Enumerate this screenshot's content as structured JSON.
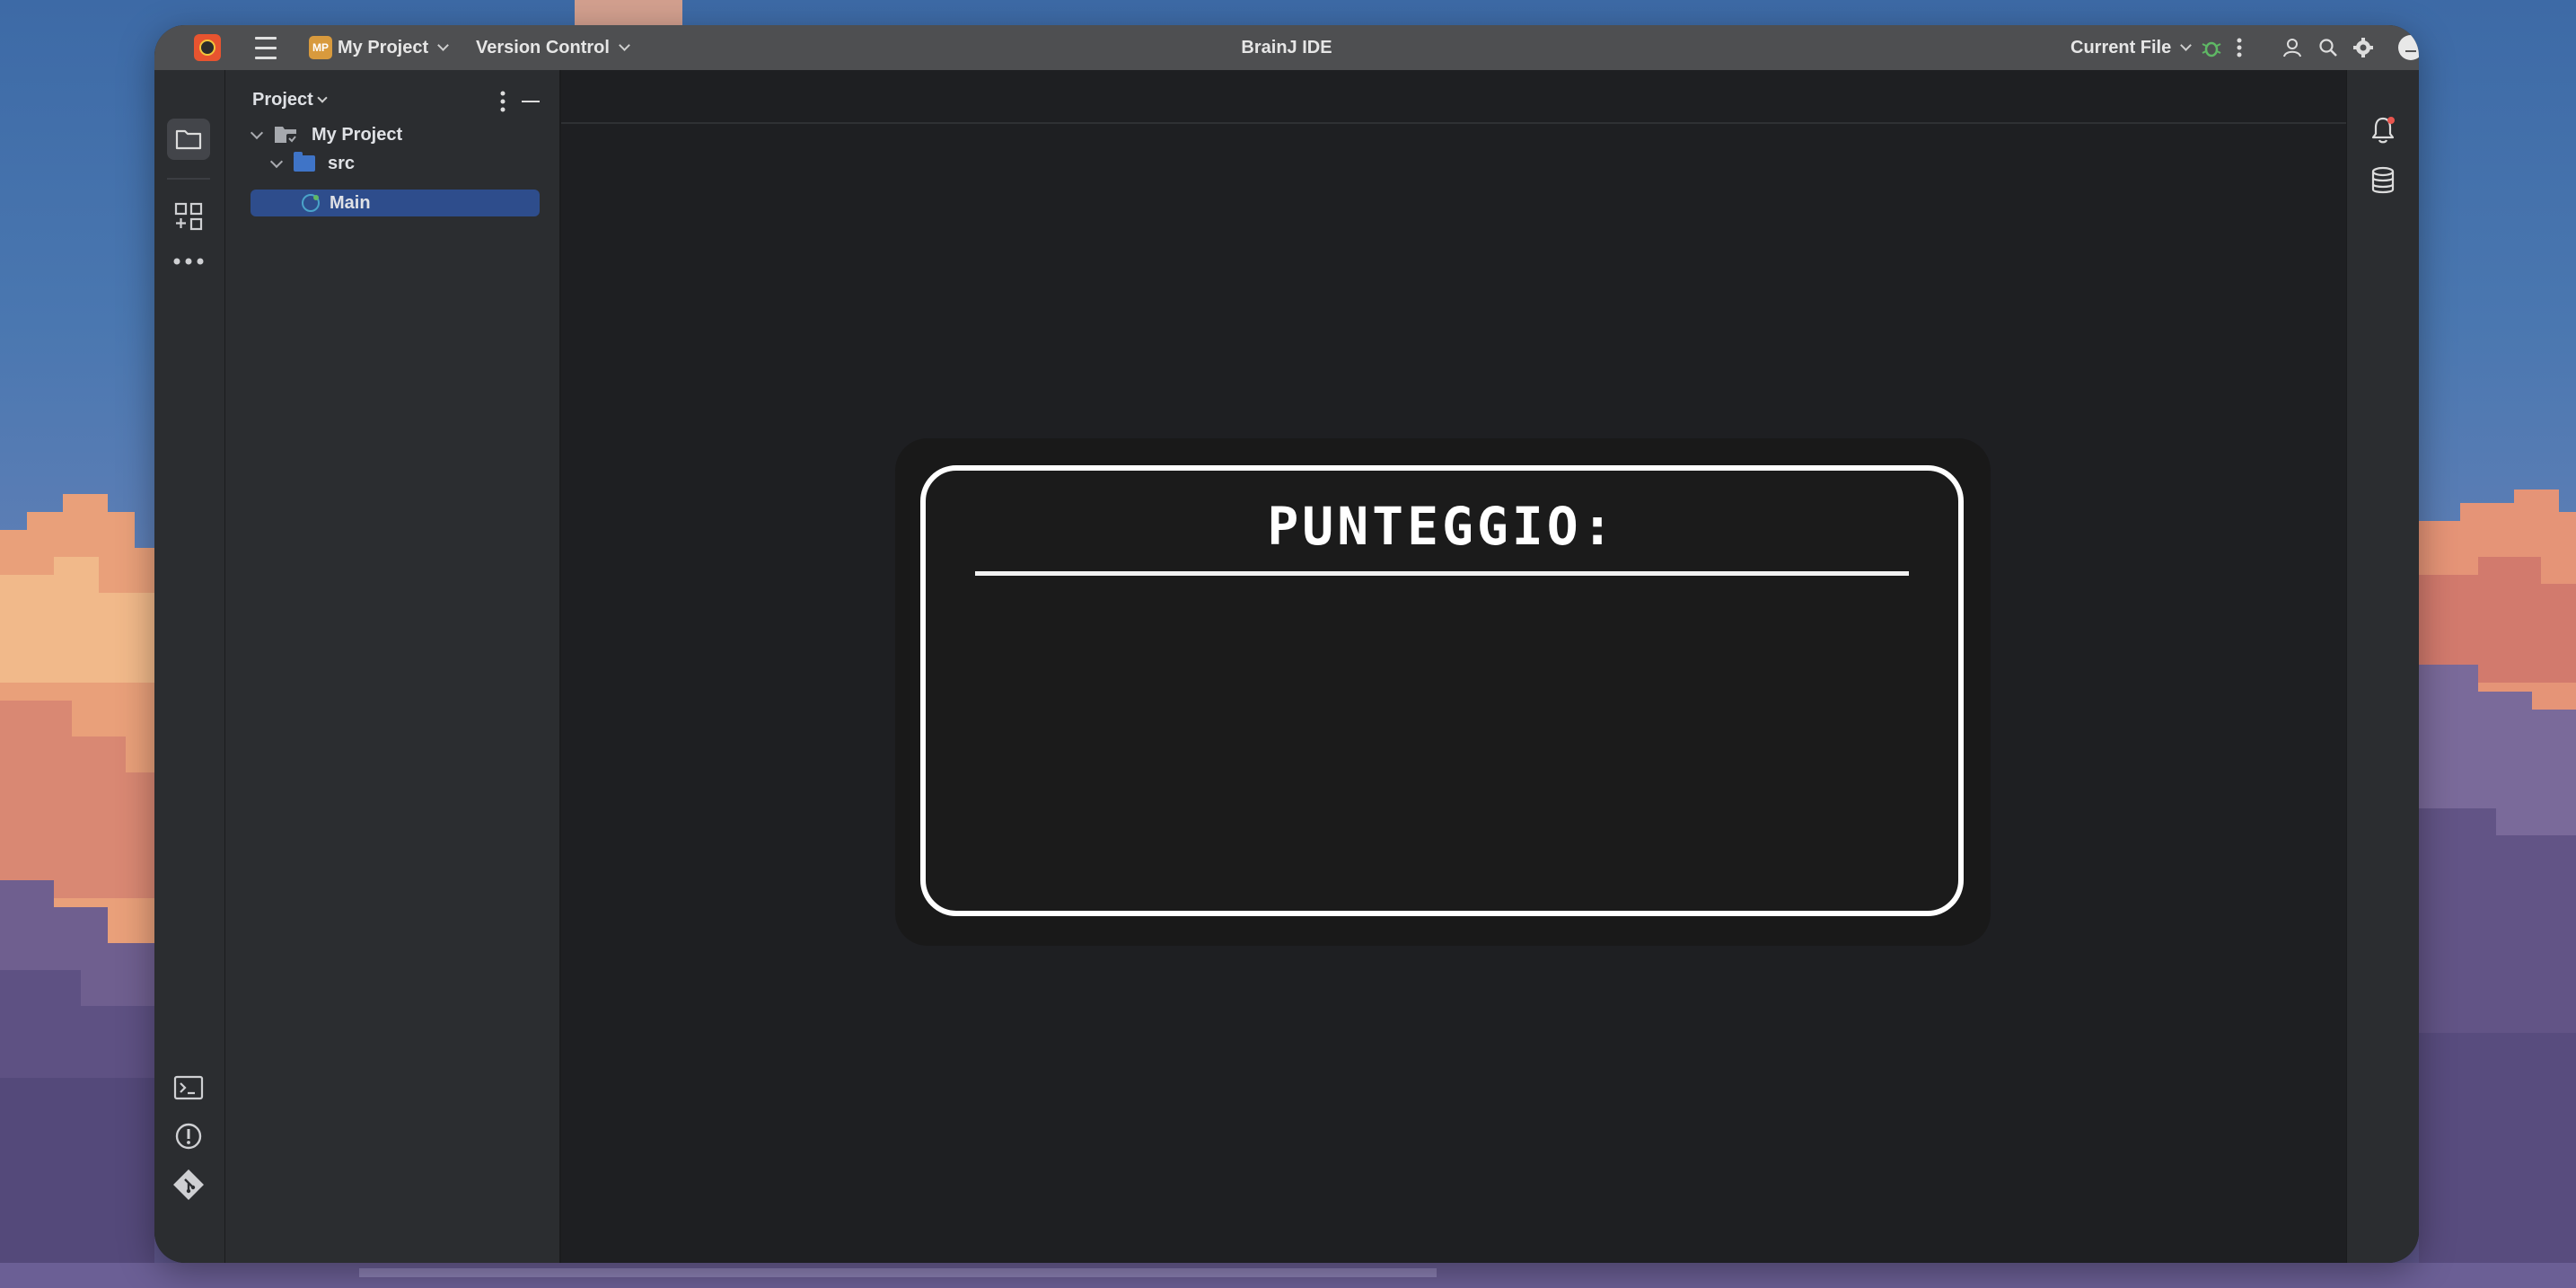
{
  "titlebar": {
    "project_badge": "MP",
    "project_name": "My Project",
    "vcs_label": "Version Control",
    "app_title": "BrainJ IDE",
    "run_config": "Current File"
  },
  "project_panel": {
    "header": "Project",
    "tree": [
      {
        "label": "My Project",
        "level": 0
      },
      {
        "label": "src",
        "level": 1
      },
      {
        "label": "Main",
        "level": 2,
        "selected": true
      }
    ]
  },
  "dialog": {
    "title": "PUNTEGGIO:"
  },
  "colors": {
    "selection": "#2e4d8c",
    "titlebar": "#4e4f51",
    "panel": "#2b2d30",
    "editor": "#1e1f22",
    "badge": "#d89a3d"
  },
  "icons": {
    "left_strip_top": [
      "folder-icon",
      "structure-icon",
      "more-icon"
    ],
    "left_strip_bottom": [
      "terminal-icon",
      "problems-icon",
      "git-icon"
    ],
    "right_strip": [
      "notifications-icon",
      "database-icon"
    ]
  }
}
